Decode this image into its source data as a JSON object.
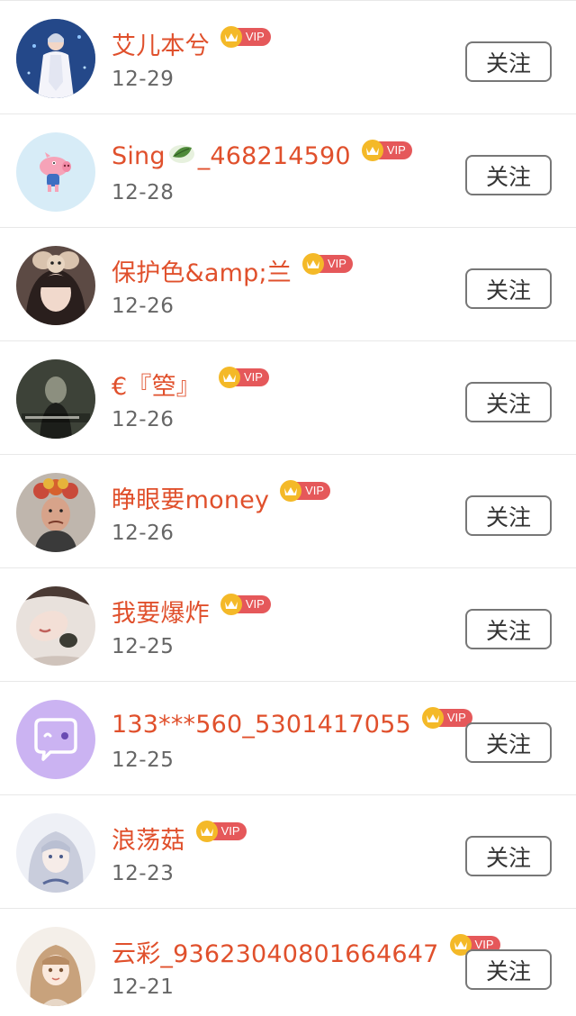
{
  "follow_label": "关注",
  "vip_label": "VIP",
  "users": [
    {
      "name": "艾儿本兮",
      "date": "12-29",
      "avatar": "avatar-singer-on-stage"
    },
    {
      "name": "Sing",
      "name_suffix": "_468214590",
      "date": "12-28",
      "avatar": "avatar-cartoon-pig",
      "name_emoji": "leaf-icon"
    },
    {
      "name": "保护色&amp;兰",
      "date": "12-26",
      "avatar": "avatar-girl-with-cat-ears"
    },
    {
      "name": "€『箜』",
      "date": "12-26",
      "avatar": "avatar-dark-poster"
    },
    {
      "name": "睁眼要money",
      "date": "12-26",
      "avatar": "avatar-woman-with-curlers"
    },
    {
      "name": "我要爆炸",
      "date": "12-25",
      "avatar": "avatar-reclining-woman"
    },
    {
      "name": "133***560_5301417055",
      "date": "12-25",
      "avatar": "avatar-default-chat-bubble"
    },
    {
      "name": "浪荡菇",
      "date": "12-23",
      "avatar": "avatar-anime-silver-hair"
    },
    {
      "name": "云彩_93623040801664647",
      "date": "12-21",
      "avatar": "avatar-anime-girl-bangs"
    }
  ],
  "colors": {
    "name": "#e0502c",
    "date": "#666666",
    "vip_badge": "#e5585a",
    "vip_crown": "#f4b928",
    "button_border": "#777777"
  }
}
